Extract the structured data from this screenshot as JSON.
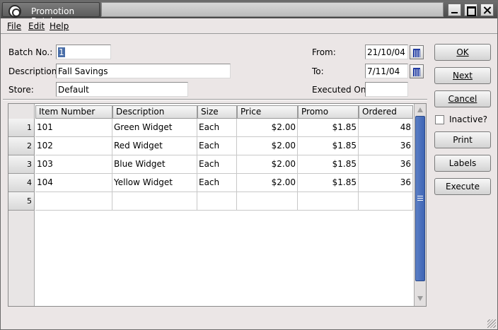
{
  "window": {
    "title": "Promotion Batch"
  },
  "menu": {
    "file": "File",
    "edit": "Edit",
    "help": "Help"
  },
  "form": {
    "batch_no_label": "Batch No.:",
    "batch_no_value": "1",
    "description_label": "Description:",
    "description_value": "Fall Savings",
    "store_label": "Store:",
    "store_value": "Default",
    "from_label": "From:",
    "from_value": "21/10/04",
    "to_label": "To:",
    "to_value": "7/11/04",
    "executed_on_label": "Executed On:",
    "executed_on_value": ""
  },
  "buttons": {
    "ok": "OK",
    "next": "Next",
    "cancel": "Cancel",
    "inactive_label": "Inactive?",
    "print": "Print",
    "labels": "Labels",
    "execute": "Execute"
  },
  "grid": {
    "columns": [
      "Item Number",
      "Description",
      "Size",
      "Price",
      "Promo",
      "Ordered"
    ],
    "row_numbers": [
      "1",
      "2",
      "3",
      "4",
      "5"
    ],
    "rows": [
      [
        "101",
        "Green Widget",
        "Each",
        "$2.00",
        "$1.85",
        "48"
      ],
      [
        "102",
        "Red Widget",
        "Each",
        "$2.00",
        "$1.85",
        "36"
      ],
      [
        "103",
        "Blue Widget",
        "Each",
        "$2.00",
        "$1.85",
        "36"
      ],
      [
        "104",
        "Yellow Widget",
        "Each",
        "$2.00",
        "$1.85",
        "36"
      ],
      [
        "",
        "",
        "",
        "",
        "",
        ""
      ]
    ]
  }
}
